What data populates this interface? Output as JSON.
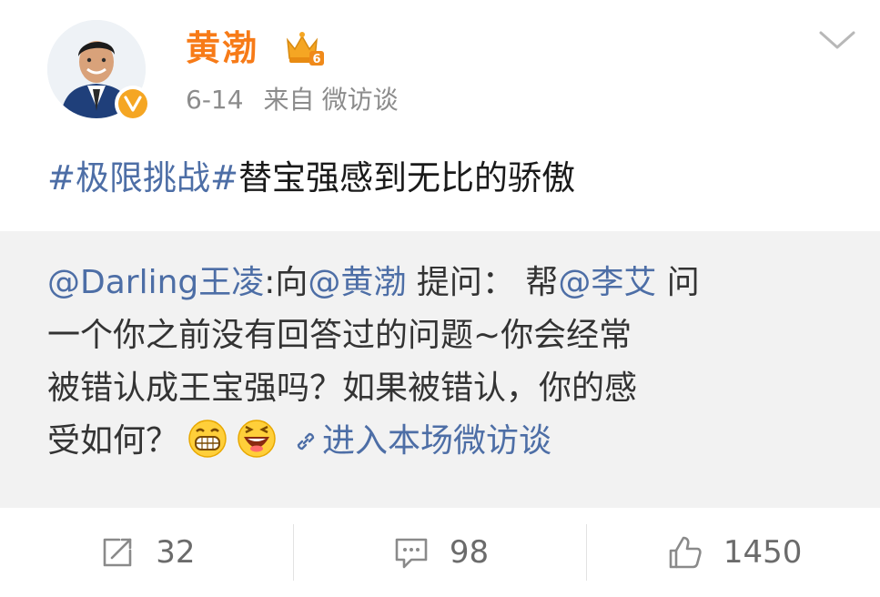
{
  "post": {
    "author": {
      "name": "黄渤",
      "avatar_icon": "person-avatar",
      "verified_badge_icon": "verified-v-icon",
      "member_icon": "crown-member-icon",
      "member_level": "6"
    },
    "meta": {
      "date": "6-14",
      "source_prefix": "来自",
      "source": "微访谈"
    },
    "menu_icon": "chevron-down-icon",
    "text": {
      "hashtag": "#极限挑战#",
      "body": "替宝强感到无比的骄傲"
    },
    "quote": {
      "asker": "@Darling王凌",
      "sep1": ":向",
      "target": "@黄渤",
      "ask_label": " 提问： 帮",
      "mention2": "@李艾",
      "line1_tail": " 问",
      "line2": "一个你之前没有回答过的问题~你会经常",
      "line3": "被错认成王宝强吗？如果被错认，你的感",
      "line4": "受如何？",
      "emojis": [
        "grin-emoji",
        "laugh-emoji"
      ],
      "link_icon": "link-icon",
      "link_text": "进入本场微访谈"
    },
    "actions": {
      "repost": {
        "icon": "repost-icon",
        "count": "32"
      },
      "comment": {
        "icon": "comment-icon",
        "count": "98"
      },
      "like": {
        "icon": "thumbs-up-icon",
        "count": "1450"
      }
    }
  },
  "colors": {
    "username": "#f77b18",
    "link": "#4d6ea6",
    "meta": "#8c8c8c",
    "quote_bg": "#f2f2f2",
    "action_text": "#6b6b6b"
  }
}
